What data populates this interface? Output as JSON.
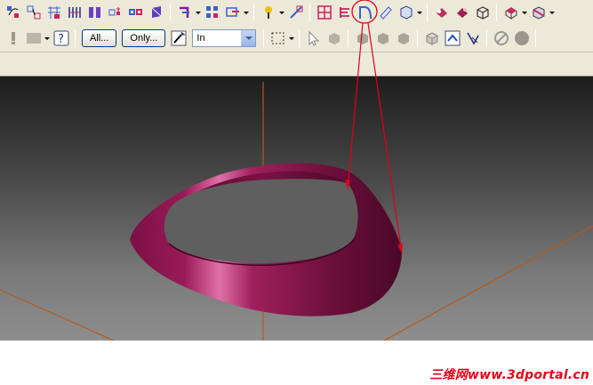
{
  "toolbar": {
    "all_button_label": "All...",
    "only_button_label": "Only...",
    "filter_select_value": "In",
    "filter_select_options": [
      "In"
    ]
  },
  "icons": {
    "row1": [
      "curve-icon",
      "ruled-surface-icon",
      "network-icon",
      "lofted-icon",
      "swept-icon",
      "revolved-icon",
      "extrude-icon",
      "skin-icon",
      "blend-icon",
      "trim-icon",
      "sew-icon",
      "offset-icon",
      "view-orient-icon",
      "hatch-surface-icon",
      "fillet-surface-icon",
      "shell-icon",
      "shaded-view-icon",
      "component-icon",
      "hide-icon",
      "wireframe-icon",
      "render-icon"
    ],
    "row2": [
      "warning-icon",
      "disabled-icon",
      "help-icon",
      "magic-wand-icon",
      "selection-box-icon",
      "select-arrow-icon",
      "solid-icon",
      "face-icon",
      "edge-icon",
      "vertex-icon",
      "isometric-icon",
      "hinge-icon",
      "pen-select-icon",
      "no-entry-icon",
      "sphere-icon"
    ]
  },
  "colors": {
    "toolbar_bg": "#ece9d8",
    "surface": "#8a1a4e",
    "annotation_red": "#e0001a",
    "axis_orange": "#b35a1a"
  },
  "watermark": {
    "text": "三维网www.3dportal.cn"
  }
}
